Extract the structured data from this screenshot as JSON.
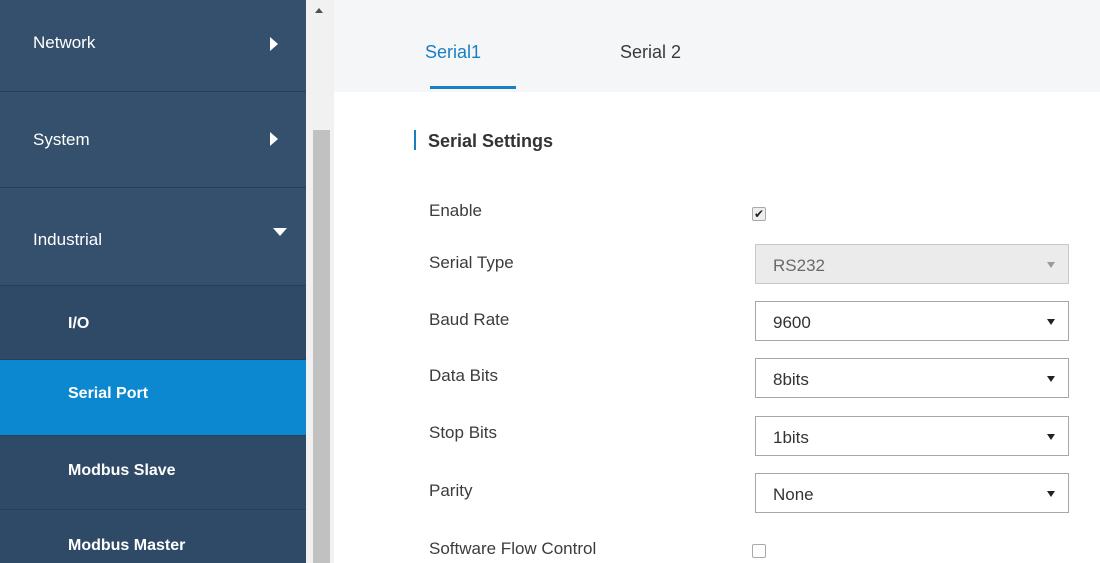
{
  "sidebar": {
    "items": [
      {
        "label": "Network",
        "icon": "chevron-right-icon"
      },
      {
        "label": "System",
        "icon": "chevron-right-icon"
      },
      {
        "label": "Industrial",
        "icon": "chevron-down-icon"
      }
    ],
    "subitems": [
      {
        "label": "I/O"
      },
      {
        "label": "Serial Port",
        "active": true
      },
      {
        "label": "Modbus Slave"
      },
      {
        "label": "Modbus Master"
      }
    ]
  },
  "tabs": [
    {
      "label": "Serial1",
      "active": true
    },
    {
      "label": "Serial 2"
    }
  ],
  "section": {
    "title": "Serial Settings"
  },
  "form": {
    "enable": {
      "label": "Enable",
      "checked": true
    },
    "serial_type": {
      "label": "Serial Type",
      "value": "RS232",
      "disabled": true
    },
    "baud_rate": {
      "label": "Baud Rate",
      "value": "9600"
    },
    "data_bits": {
      "label": "Data Bits",
      "value": "8bits"
    },
    "stop_bits": {
      "label": "Stop Bits",
      "value": "1bits"
    },
    "parity": {
      "label": "Parity",
      "value": "None"
    },
    "software_flow_control": {
      "label": "Software Flow Control",
      "checked": false
    }
  },
  "colors": {
    "sidebar_bg": "#2f4a66",
    "active_item": "#0b88cf",
    "accent": "#1a7fc1"
  }
}
